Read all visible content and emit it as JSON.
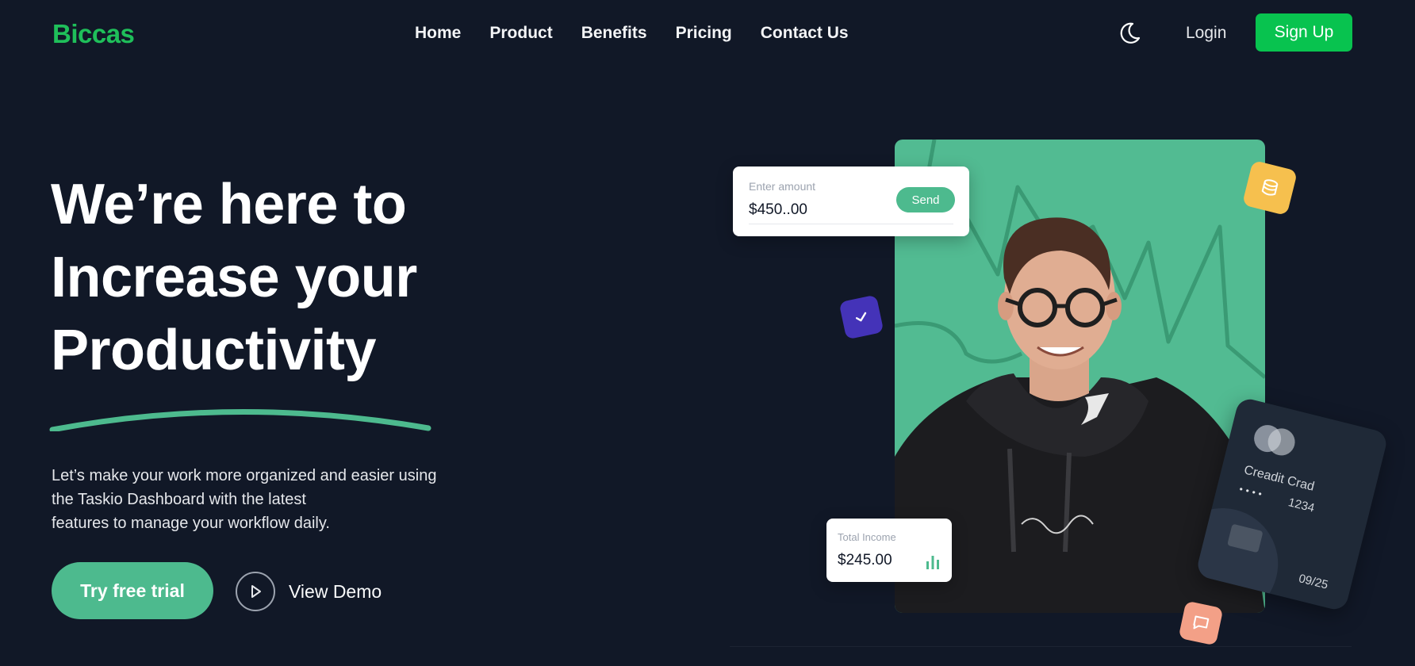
{
  "nav": {
    "logo": "Biccas",
    "links": [
      "Home",
      "Product",
      "Benefits",
      "Pricing",
      "Contact Us"
    ],
    "theme_icon": "moon-icon",
    "login_label": "Login",
    "signup_label": "Sign Up"
  },
  "hero": {
    "title_lines": [
      "We’re here to",
      "Increase your",
      "Productivity"
    ],
    "description_lines": [
      "Let’s make your work more organized and easier using",
      "the Taskio Dashboard with the latest",
      "features to manage your workflow daily."
    ],
    "trial_label": "Try free trial",
    "demo_label": "View Demo"
  },
  "widgets": {
    "amount_card": {
      "label": "Enter amount",
      "value": "$450..00",
      "send_label": "Send"
    },
    "income_card": {
      "label": "Total Income",
      "value": "$245.00"
    },
    "credit_card": {
      "name": "Creadit Crad",
      "dots": "••••",
      "number": "1234",
      "expiry": "09/25"
    },
    "badges": [
      "coin-stack-icon",
      "check-icon",
      "chat-icon"
    ]
  },
  "colors": {
    "background": "#111827",
    "brand_green": "#1fbf5a",
    "signup_green": "#08c34f",
    "accent_teal": "#4dba8e",
    "coin_yellow": "#f6c04e",
    "check_purple": "#4433b8",
    "chat_peach": "#f3a087"
  }
}
